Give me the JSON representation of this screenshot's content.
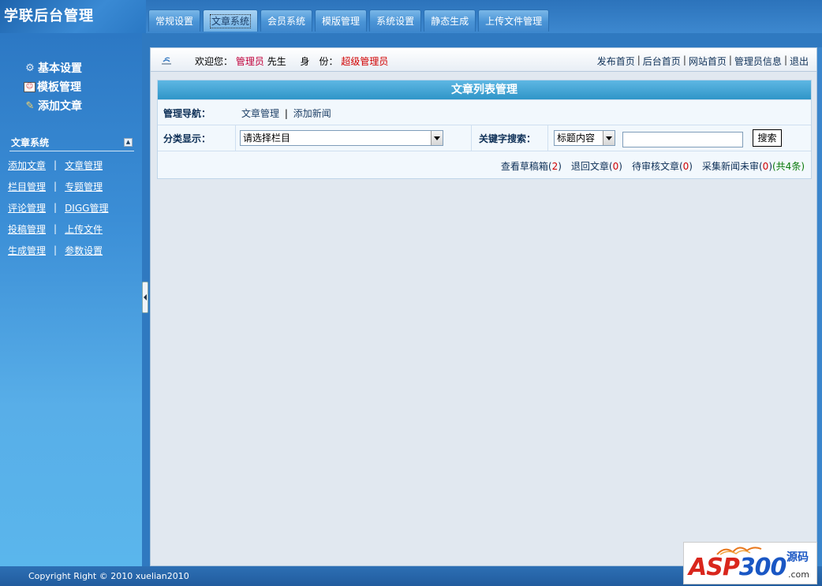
{
  "app": {
    "title": "学联后台管理"
  },
  "tabs": [
    {
      "label": "常规设置",
      "active": false
    },
    {
      "label": "文章系统",
      "active": true
    },
    {
      "label": "会员系统",
      "active": false
    },
    {
      "label": "模版管理",
      "active": false
    },
    {
      "label": "系统设置",
      "active": false
    },
    {
      "label": "静态生成",
      "active": false
    },
    {
      "label": "上传文件管理",
      "active": false
    }
  ],
  "sidebar": {
    "quick": [
      {
        "label": "基本设置",
        "icon": "gear-icon"
      },
      {
        "label": "模板管理",
        "icon": "template-icon"
      },
      {
        "label": "添加文章",
        "icon": "add-article-icon"
      }
    ],
    "section_title": "文章系统",
    "links": [
      [
        "添加文章",
        "文章管理"
      ],
      [
        "栏目管理",
        "专题管理"
      ],
      [
        "评论管理",
        "DIGG管理"
      ],
      [
        "投稿管理",
        "上传文件"
      ],
      [
        "生成管理",
        "参数设置"
      ]
    ],
    "separator": "|"
  },
  "infobar": {
    "welcome": "欢迎您：",
    "user": "管理员",
    "salutation": "先生",
    "role_label": "身　份：",
    "role": "超级管理员",
    "links": [
      "发布首页",
      "后台首页",
      "网站首页",
      "管理员信息",
      "退出"
    ],
    "sep": "|"
  },
  "panel": {
    "title": "文章列表管理",
    "nav_label": "管理导航：",
    "nav_links": [
      "文章管理",
      "添加新闻"
    ],
    "nav_sep": "|",
    "category_label": "分类显示：",
    "category_select": "请选择栏目",
    "keyword_label": "关键字搜索：",
    "keyword_field_select": "标题内容",
    "keyword_value": "",
    "search_button": "搜索",
    "stats": {
      "draft_label": "查看草稿箱",
      "draft_count": "2",
      "returned_label": "退回文章",
      "returned_count": "0",
      "pending_label": "待审核文章",
      "pending_count": "0",
      "collected_label": "采集新闻未审",
      "collected_count": "0",
      "total": "(共4条)",
      "open": "(",
      "close": ")"
    }
  },
  "footer": {
    "copyright": "Copyright Right © 2010 xuelian2010"
  },
  "watermark": {
    "brand_a": "ASP",
    "brand_b": "300",
    "cn": "源码",
    "com": ".com"
  },
  "colors": {
    "accent": "#2f79c0",
    "highlight": "#c0003a",
    "count": "#d10000",
    "total": "#0a7a0a"
  }
}
